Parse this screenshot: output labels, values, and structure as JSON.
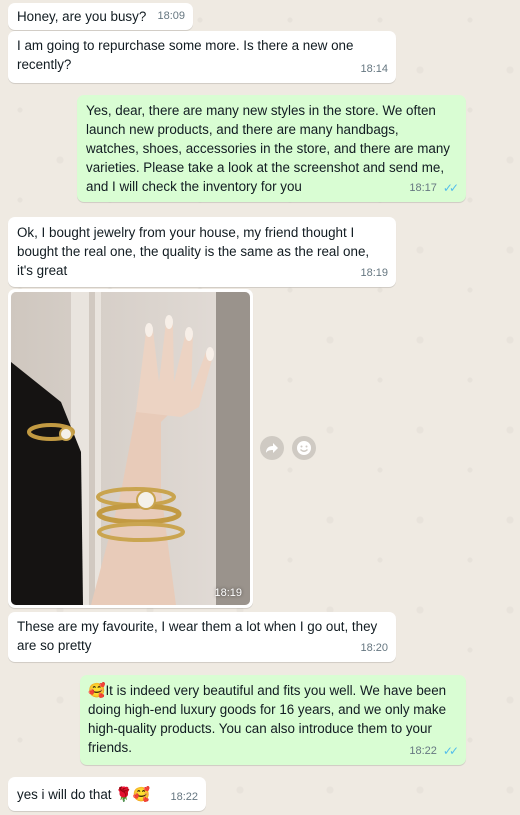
{
  "messages": [
    {
      "text": "Honey, are you busy?",
      "time": "18:09"
    },
    {
      "text": "I am going to repurchase some more. Is there a new one recently?",
      "time": "18:14"
    },
    {
      "text": "Yes, dear, there are many new styles in the store. We often launch new products, and there are many handbags, watches, shoes, accessories in the store, and there are many varieties. Please take a look at the screenshot and send me, and I will check the inventory for you",
      "time": "18:17"
    },
    {
      "text": "Ok, I bought jewelry from your house, my friend thought I bought the real one, the quality is the same as the real one, it's great",
      "time": "18:19"
    },
    {
      "time": "18:19"
    },
    {
      "text": "These are my favourite, I wear them a lot when I go out, they are so pretty",
      "time": "18:20"
    },
    {
      "emoji": "🥰",
      "text": "It is indeed very beautiful and fits you well. We have been doing high-end luxury goods for 16 years, and we only make high-quality products. You can also introduce them to your friends.",
      "time": "18:22"
    },
    {
      "text": "yes i will do that",
      "emoji": "🌹🥰",
      "time": "18:22"
    }
  ],
  "icons": {
    "forward": "forward-icon",
    "react": "smiley-icon",
    "read_receipt": "double-check-icon"
  },
  "colors": {
    "background": "#efeae2",
    "incoming": "#ffffff",
    "outgoing": "#d9fdd3",
    "read_tick": "#53bdeb",
    "timestamp": "#667781"
  }
}
